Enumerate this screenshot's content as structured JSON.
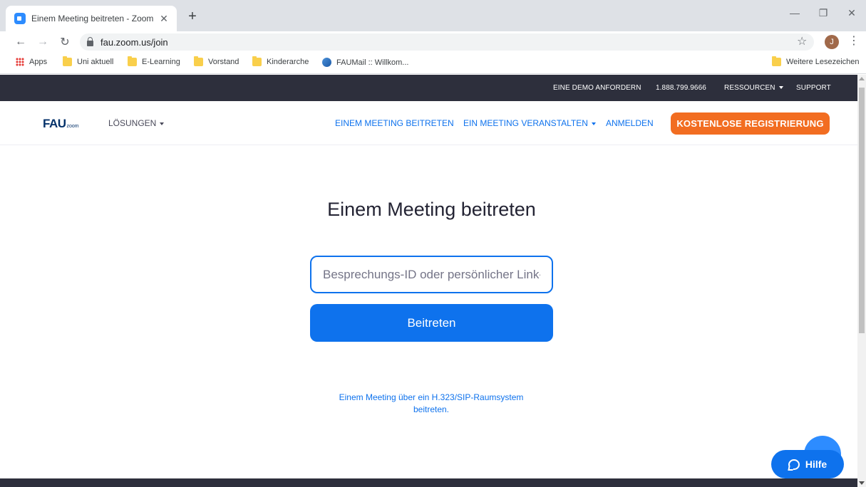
{
  "browser": {
    "tab_title": "Einem Meeting beitreten - Zoom",
    "tab_close": "✕",
    "new_tab": "+",
    "url": "fau.zoom.us/join",
    "profile_initial": "J",
    "win_minimize": "—",
    "win_restore": "❐",
    "win_close": "✕",
    "back": "←",
    "forward": "→",
    "reload": "↻",
    "star": "☆",
    "menu": "⋮",
    "bookmarks": [
      {
        "label": "Apps",
        "icon": "apps-grid-icon"
      },
      {
        "label": "Uni aktuell",
        "icon": "folder-icon"
      },
      {
        "label": "E-Learning",
        "icon": "folder-icon"
      },
      {
        "label": "Vorstand",
        "icon": "folder-icon"
      },
      {
        "label": "Kinderarche",
        "icon": "folder-icon"
      },
      {
        "label": "FAUMail :: Willkom...",
        "icon": "fau-mail-icon"
      }
    ],
    "other_bookmarks": "Weitere Lesezeichen"
  },
  "topbar": {
    "demo": "EINE DEMO ANFORDERN",
    "phone": "1.888.799.9666",
    "resources": "RESSOURCEN",
    "support": "SUPPORT"
  },
  "nav": {
    "logo_main": "FAU",
    "logo_sub": "zoom",
    "solutions": "LÖSUNGEN",
    "join": "EINEM MEETING BEITRETEN",
    "host": "EIN MEETING VERANSTALTEN",
    "signin": "ANMELDEN",
    "register": "KOSTENLOSE REGISTRIERUNG"
  },
  "main": {
    "title": "Einem Meeting beitreten",
    "input_placeholder": "Besprechungs-ID oder persönlicher Link-Name",
    "input_value": "",
    "join_button": "Beitreten",
    "sip_link": "Einem Meeting über ein H.323/SIP-Raumsystem beitreten."
  },
  "help": {
    "label": "Hilfe"
  },
  "colors": {
    "zoom_blue": "#0e72ed",
    "register_orange": "#f26d21",
    "topbar_dark": "#2d2f3c"
  }
}
